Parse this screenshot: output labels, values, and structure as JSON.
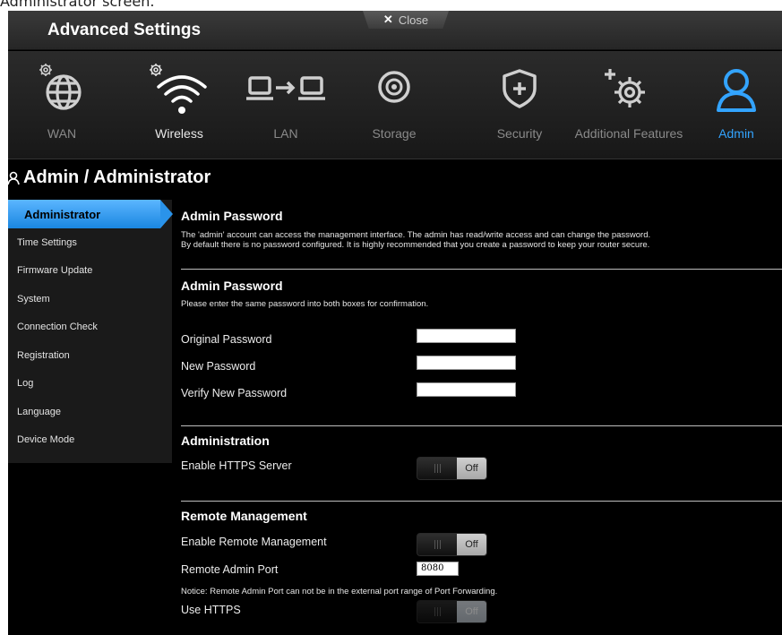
{
  "page": {
    "top_caption": "Administrator screen."
  },
  "header": {
    "title": "Advanced Settings",
    "close_icon": "close-x-icon",
    "close_label": "Close"
  },
  "nav": {
    "items": [
      {
        "label": "WAN",
        "icon": "globe-gear-icon"
      },
      {
        "label": "Wireless",
        "icon": "wifi-gear-icon"
      },
      {
        "label": "LAN",
        "icon": "lan-computers-icon"
      },
      {
        "label": "Storage",
        "icon": "disc-icon"
      },
      {
        "label": "Security",
        "icon": "shield-plus-icon"
      },
      {
        "label": "Additional Features",
        "icon": "gear-plus-icon"
      },
      {
        "label": "Admin",
        "icon": "user-icon"
      }
    ],
    "active_color": "#33a4ff"
  },
  "section": {
    "title": "Admin / Administrator"
  },
  "sidebar": {
    "items": [
      {
        "label": "Administrator",
        "active": true
      },
      {
        "label": "Time Settings"
      },
      {
        "label": "Firmware Update"
      },
      {
        "label": "System"
      },
      {
        "label": "Connection Check"
      },
      {
        "label": "Registration"
      },
      {
        "label": "Log"
      },
      {
        "label": "Language"
      },
      {
        "label": "Device Mode"
      }
    ]
  },
  "content": {
    "intro": {
      "heading": "Admin Password",
      "line1": "The 'admin' account can access the management interface. The admin has read/write access and can change the password.",
      "line2": "By default there is no password configured. It is highly recommended that you create a password to keep your router secure."
    },
    "password": {
      "heading": "Admin Password",
      "instructions": "Please enter the same password into both boxes for confirmation.",
      "original_label": "Original Password",
      "original_value": "",
      "new_label": "New Password",
      "new_value": "",
      "verify_label": "Verify New Password",
      "verify_value": ""
    },
    "administration": {
      "heading": "Administration",
      "https_label": "Enable HTTPS Server",
      "https_state": "Off"
    },
    "remote": {
      "heading": "Remote Management",
      "enable_label": "Enable Remote Management",
      "enable_state": "Off",
      "port_label": "Remote Admin Port",
      "port_value": "8080",
      "notice": "Notice: Remote Admin Port can not be in the external port range of Port Forwarding.",
      "use_https_label": "Use HTTPS",
      "use_https_state": "Off"
    }
  }
}
